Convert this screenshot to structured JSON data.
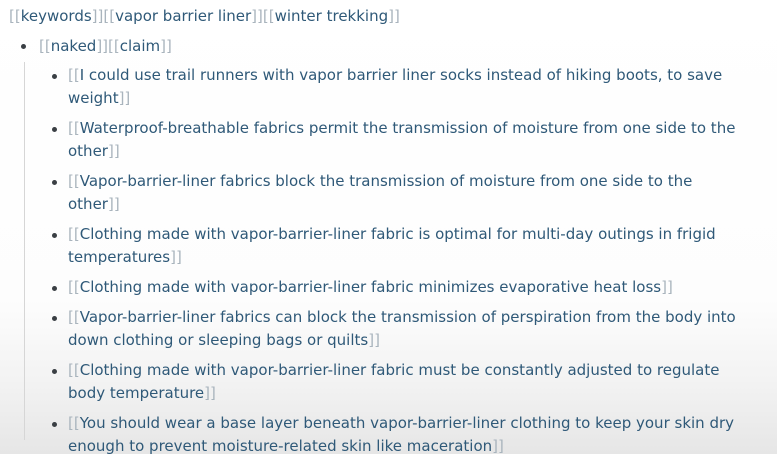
{
  "keywords": {
    "links": [
      "keywords",
      "vapor barrier liner",
      "winter trekking"
    ]
  },
  "outer": {
    "links": [
      "naked",
      "claim"
    ]
  },
  "claims": [
    "I could use trail runners with vapor barrier liner socks instead of hiking boots, to save weight",
    "Waterproof-breathable fabrics permit the transmission of moisture from one side to the other",
    "Vapor-barrier-liner fabrics block the transmission of moisture from one side to the other",
    "Clothing made with vapor-barrier-liner fabric is optimal for multi-day outings in frigid temperatures",
    "Clothing made with vapor-barrier-liner fabric minimizes evaporative heat loss",
    "Vapor-barrier-liner fabrics can block the transmission of perspiration from the body into down clothing or sleeping bags or quilts",
    "Clothing made with vapor-barrier-liner fabric must be constantly adjusted to regulate body temperature",
    "You should wear a base layer beneath vapor-barrier-liner clothing to keep your skin dry enough to prevent moisture-related skin like maceration"
  ],
  "colors": {
    "link": "#2f5978",
    "brackets": "#a9b4bd",
    "bullet": "#3a3f44"
  }
}
